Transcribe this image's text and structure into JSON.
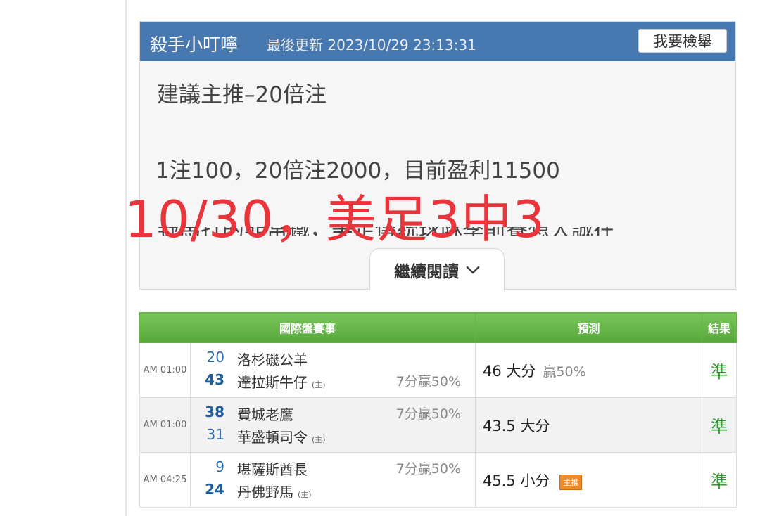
{
  "card": {
    "author": "殺手小叮嚀",
    "updated": "最後更新 2023/10/29 23:13:31",
    "report_button": "我要檢舉",
    "recommend": "建議主推–20倍注",
    "stake": "1注100，20倍注2000，目前盈利11500",
    "overlay": "10/30，美足3中3",
    "clipped_line": "野馬打的非常鐵，美足傳統球隊季前賽想大誠在",
    "continue": "繼續閱讀"
  },
  "table": {
    "headers": {
      "event": "國際盤賽事",
      "prediction": "預測",
      "result": "結果"
    },
    "rows": [
      {
        "time": "AM 01:00",
        "team1_score": "20",
        "team1": "洛杉磯公羊",
        "team1_home": "",
        "team1_spread": "",
        "team2_score": "43",
        "team2": "達拉斯牛仔",
        "team2_home": "(主)",
        "team2_spread": "7分贏50%",
        "pred": "46 大分",
        "pred_extra": "贏50%",
        "badge": "",
        "result": "準"
      },
      {
        "time": "AM 01:00",
        "team1_score": "38",
        "team1": "費城老鷹",
        "team1_home": "",
        "team1_spread": "7分贏50%",
        "team2_score": "31",
        "team2": "華盛頓司令",
        "team2_home": "(主)",
        "team2_spread": "",
        "pred": "43.5 大分",
        "pred_extra": "",
        "badge": "",
        "result": "準"
      },
      {
        "time": "AM 04:25",
        "team1_score": "9",
        "team1": "堪薩斯酋長",
        "team1_home": "",
        "team1_spread": "7分贏50%",
        "team2_score": "24",
        "team2": "丹佛野馬",
        "team2_home": "(主)",
        "team2_spread": "",
        "pred": "45.5 小分",
        "pred_extra": "",
        "badge": "主推",
        "result": "準"
      }
    ]
  },
  "colors": {
    "header_blue": "#4779b0",
    "table_green": "#5fb043",
    "overlay_red": "#e8343a",
    "result_green": "#2f9a2f",
    "badge_orange": "#ee8a2a"
  },
  "icons": {
    "continue": "chevron-down-icon"
  }
}
